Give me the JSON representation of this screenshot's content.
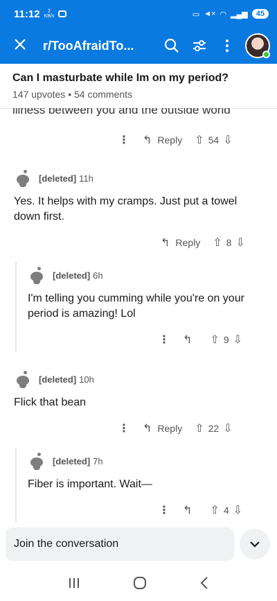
{
  "status": {
    "time": "11:12",
    "net_speed_value": "2",
    "net_speed_unit": "KB/s",
    "battery": "45"
  },
  "appbar": {
    "subreddit": "r/TooAfraidTo..."
  },
  "post": {
    "title": "Can I masturbate while Im on my period?",
    "upvotes": "147 upvotes",
    "separator": "•",
    "comments": "54 comments"
  },
  "cutoff_text": "illness between you and the outside world",
  "actions_top": {
    "reply_label": "Reply",
    "score": "54"
  },
  "comments": [
    {
      "user": "[deleted]",
      "age": "11h",
      "text": "Yes. It helps with my cramps. Just put a towel down first.",
      "reply_label": "Reply",
      "score": "8"
    },
    {
      "user": "[deleted]",
      "age": "6h",
      "text": "I'm telling you cumming while you're on your period is amazing! Lol",
      "score": "9"
    },
    {
      "user": "[deleted]",
      "age": "10h",
      "text": "Flick that bean",
      "reply_label": "Reply",
      "score": "22"
    },
    {
      "user": "[deleted]",
      "age": "7h",
      "text": "Fiber is important. Wait—",
      "score": "4"
    }
  ],
  "composer": {
    "placeholder": "Join the conversation"
  },
  "icons": {
    "close": "close-icon",
    "search": "search-icon",
    "filter": "filter-icon",
    "more": "more-vertical-icon",
    "reply": "reply-arrow-icon",
    "upvote": "upvote-icon",
    "downvote": "downvote-icon",
    "chevron": "chevron-down-icon"
  },
  "colors": {
    "brand_bar": "#0a7ae0",
    "online": "#2ecc40"
  }
}
